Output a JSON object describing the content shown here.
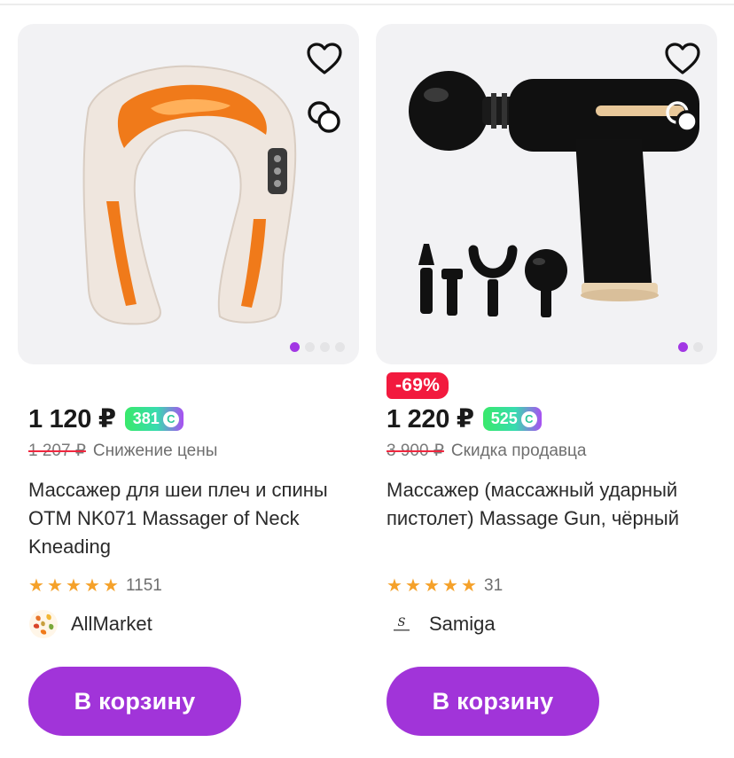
{
  "colors": {
    "accent": "#a134d9",
    "discount": "#f21a3e",
    "star": "#f5a12a",
    "dot_active": "#a237e4"
  },
  "products": [
    {
      "image_subject": "neck-shoulder-massager",
      "favorite_icon": "heart-icon",
      "compare_icon": "compare-icon",
      "gallery": {
        "total": 4,
        "active": 1
      },
      "discount": "",
      "price": "1 120 ₽",
      "bonus": "381",
      "bonus_icon": "bonus-coin-icon",
      "old_price": "1 207 ₽",
      "old_note": "Снижение цены",
      "title": "Массажер для шеи плеч и спины OTM NK071 Massager of Neck Kneading",
      "rating": 5,
      "reviews": "1151",
      "seller_name": "AllMarket",
      "seller_logo_icon": "autumn-leaves-logo-icon",
      "cart_label": "В корзину"
    },
    {
      "image_subject": "massage-gun-black",
      "favorite_icon": "heart-icon",
      "compare_icon": "compare-icon",
      "gallery": {
        "total": 2,
        "active": 1
      },
      "discount": "-69%",
      "price": "1 220 ₽",
      "bonus": "525",
      "bonus_icon": "bonus-coin-icon",
      "old_price": "3 900 ₽",
      "old_note": "Скидка продавца",
      "title": "Массажер (массажный ударный пистолет) Massage Gun, чёрный",
      "rating": 5,
      "reviews": "31",
      "seller_name": "Samiga",
      "seller_logo_icon": "samiga-logo-icon",
      "cart_label": "В корзину"
    }
  ]
}
